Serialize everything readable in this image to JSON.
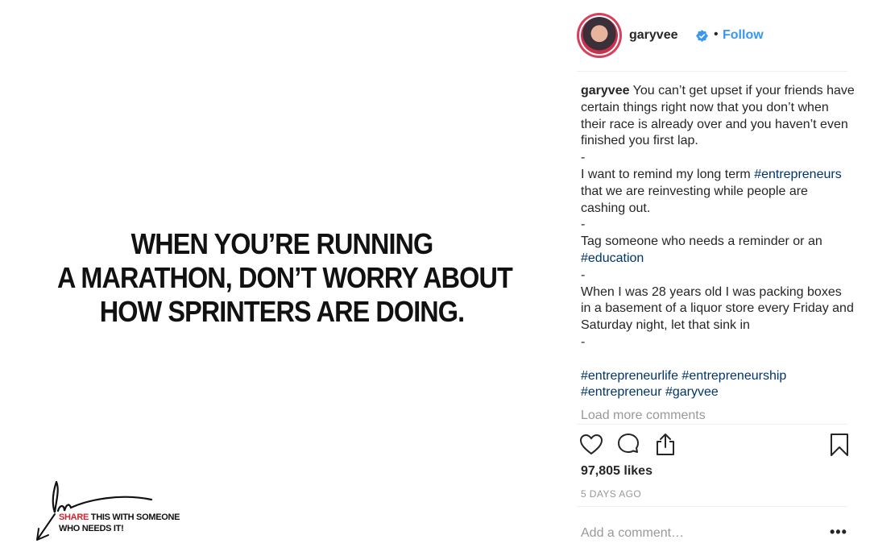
{
  "post": {
    "quote_lines": [
      "WHEN YOU’RE RUNNING",
      "A MARATHON, DON’T WORRY ABOUT",
      "HOW SPRINTERS ARE DOING."
    ],
    "share_line1_red": "SHARE",
    "share_line1_rest": " THIS WITH SOMEONE",
    "share_line2": "WHO NEEDS IT!"
  },
  "header": {
    "username": "garyvee",
    "dot": "•",
    "follow_label": "Follow"
  },
  "caption": {
    "username": "garyvee",
    "paragraph1": "You can’t get upset if your friends have certain things right now that you don’t when their race is already over and you haven’t even finished you first lap.",
    "dash": "-",
    "paragraph2_before": "I want to remind my long term ",
    "paragraph2_tag": "#entrepreneurs",
    "paragraph2_after": " that we are reinvesting while people are cashing out.",
    "paragraph3_before": "Tag someone who needs a reminder or an ",
    "paragraph3_tag": "#education",
    "paragraph4": "When I was 28 years old I was packing boxes in a basement of a liquor store every Friday and Saturday night, let that sink in",
    "hashtags": [
      "#entrepreneurlife",
      "#entrepreneurship",
      "#entrepreneur",
      "#garyvee"
    ]
  },
  "load_more": "Load more comments",
  "likes": "97,805 likes",
  "time_ago": "5 DAYS AGO",
  "comment_placeholder": "Add a comment…",
  "more_label": "•••",
  "icons": {
    "like": "heart-icon",
    "comment": "comment-bubble-icon",
    "share": "share-icon",
    "save": "bookmark-icon",
    "verified": "verified-badge-icon"
  },
  "colors": {
    "link_blue": "#3897f0",
    "hashtag": "#003569",
    "muted": "#999999",
    "share_red": "#d3232f"
  }
}
